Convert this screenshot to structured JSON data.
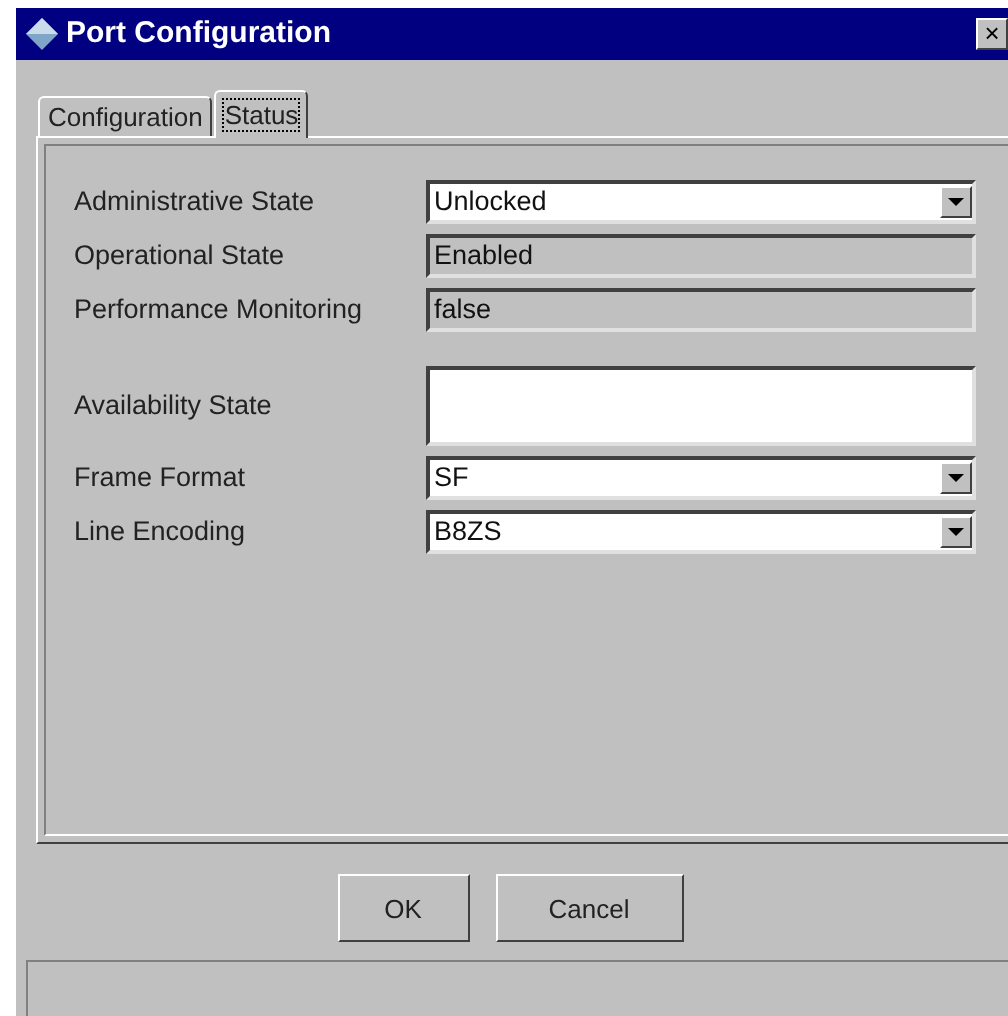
{
  "window": {
    "title": "Port Configuration",
    "close": "×"
  },
  "tabs": [
    {
      "label": "Configuration",
      "selected": false
    },
    {
      "label": "Status",
      "selected": true
    }
  ],
  "fields": [
    {
      "kind": "combo",
      "label": "Administrative State",
      "value": "Unlocked"
    },
    {
      "kind": "readonly",
      "label": "Operational State",
      "value": "Enabled"
    },
    {
      "kind": "readonly",
      "label": "Performance Monitoring",
      "value": "false"
    },
    {
      "kind": "text",
      "label": "Availability State"
    },
    {
      "kind": "combo",
      "label": "Frame Format",
      "value": "SF"
    },
    {
      "kind": "combo",
      "label": "Line Encoding",
      "value": "B8ZS"
    }
  ],
  "buttons": [
    "OK",
    "Cancel"
  ]
}
